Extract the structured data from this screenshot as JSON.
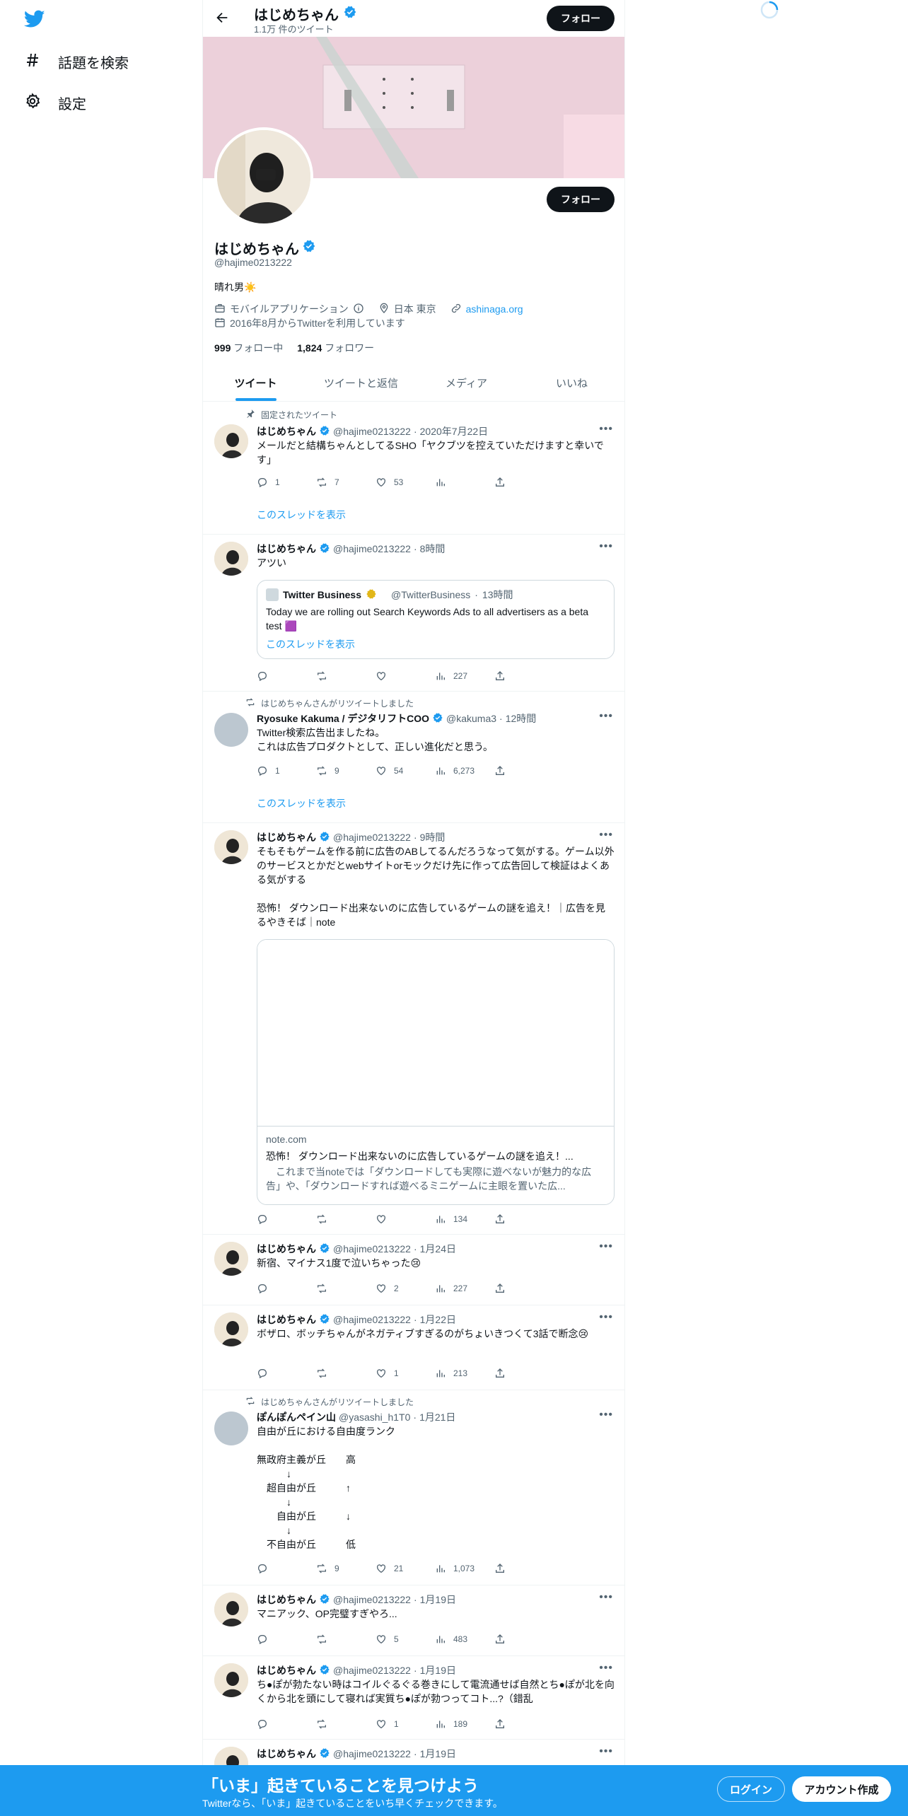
{
  "nav": {
    "explore_label": "話題を検索",
    "settings_label": "設定"
  },
  "header": {
    "name": "はじめちゃん",
    "tweet_count": "1.1万 件のツイート",
    "follow_label": "フォロー"
  },
  "profile": {
    "name": "はじめちゃん",
    "handle": "@hajime0213222",
    "bio": "晴れ男☀️",
    "category": "モバイルアプリケーション",
    "location": "日本 東京",
    "website": "ashinaga.org",
    "joined": "2016年8月からTwitterを利用しています",
    "following_count": "999",
    "following_label": "フォロー中",
    "followers_count": "1,824",
    "followers_label": "フォロワー",
    "follow_label": "フォロー"
  },
  "tabs": [
    "ツイート",
    "ツイートと返信",
    "メディア",
    "いいね"
  ],
  "show_thread": "このスレッドを表示",
  "tweets": [
    {
      "social": "固定されたツイート",
      "name": "はじめちゃん",
      "handle": "@hajime0213222",
      "time": "2020年7月22日",
      "text": "メールだと結構ちゃんとしてるSHO「ヤクブツを控えていただけますと幸いです」",
      "reply": "1",
      "retweet": "7",
      "like": "53",
      "views": ""
    },
    {
      "name": "はじめちゃん",
      "handle": "@hajime0213222",
      "time": "8時間",
      "text": "アツい",
      "quote": {
        "name": "Twitter Business",
        "handle": "@TwitterBusiness",
        "time": "13時間",
        "text": "Today we are rolling out Search Keywords Ads to all advertisers as a beta test 🟪",
        "show_thread": "このスレッドを表示"
      },
      "reply": "",
      "retweet": "",
      "like": "",
      "views": "227"
    },
    {
      "social": "はじめちゃんさんがリツイートしました",
      "name": "Ryosuke Kakuma / デジタリフトCOO",
      "handle": "@kakuma3",
      "time": "12時間",
      "text": "Twitter検索広告出ましたね。\nこれは広告プロダクトとして、正しい進化だと思う。",
      "reply": "1",
      "retweet": "9",
      "like": "54",
      "views": "6,273"
    },
    {
      "name": "はじめちゃん",
      "handle": "@hajime0213222",
      "time": "9時間",
      "text": "そもそもゲームを作る前に広告のABしてるんだろうなって気がする。ゲーム以外のサービスとかだとwebサイトorモックだけ先に作って広告回して検証はよくある気がする\n\n恐怖！ ダウンロード出来ないのに広告しているゲームの謎を追え！｜広告を見るやきそば｜note",
      "card": {
        "domain": "note.com",
        "title": "恐怖！ ダウンロード出来ないのに広告しているゲームの謎を追え！...",
        "desc": "　これまで当noteでは「ダウンロードしても実際に遊べないが魅力的な広告」や、「ダウンロードすれば遊べるミニゲームに主眼を置いた広..."
      },
      "reply": "",
      "retweet": "",
      "like": "",
      "views": "134"
    },
    {
      "name": "はじめちゃん",
      "handle": "@hajime0213222",
      "time": "1月24日",
      "text": "新宿、マイナス1度で泣いちゃった😢",
      "reply": "",
      "retweet": "",
      "like": "2",
      "views": "227"
    },
    {
      "name": "はじめちゃん",
      "handle": "@hajime0213222",
      "time": "1月22日",
      "text": "ボザロ、ボッチちゃんがネガティブすぎるのがちょいきつくて3話で断念😢",
      "reply": "",
      "retweet": "",
      "like": "1",
      "views": "213"
    },
    {
      "social": "はじめちゃんさんがリツイートしました",
      "name": "ぽんぽんペイン山",
      "handle": "@yasashi_h1T0",
      "time": "1月21日",
      "text": "自由が丘における自由度ランク\n\n無政府主義が丘　　高\n　　　↓\n　超自由が丘　　　↑\n　　　↓\n　　自由が丘　　　↓\n　　　↓\n　不自由が丘　　　低",
      "reply": "",
      "retweet": "9",
      "like": "21",
      "views": "1,073"
    },
    {
      "name": "はじめちゃん",
      "handle": "@hajime0213222",
      "time": "1月19日",
      "text": "マニアック、OP完璧すぎやろ...",
      "reply": "",
      "retweet": "",
      "like": "5",
      "views": "483"
    },
    {
      "name": "はじめちゃん",
      "handle": "@hajime0213222",
      "time": "1月19日",
      "text": "ち●ぽが勃たない時はコイルぐるぐる巻きにして電流通せば自然とち●ぽが北を向くから北を頭にして寝れば実質ち●ぽが勃つってコト...?（錯乱",
      "reply": "",
      "retweet": "",
      "like": "1",
      "views": "189"
    },
    {
      "name": "はじめちゃん",
      "handle": "@hajime0213222",
      "time": "1月19日"
    }
  ],
  "bottom": {
    "title": "「いま」起きていることを見つけよう",
    "subtitle": "Twitterなら、「いま」起きていることをいち早くチェックできます。",
    "login": "ログイン",
    "signup": "アカウント作成"
  },
  "colors": {
    "accent": "#1d9bf0",
    "text": "#0f1419",
    "secondary": "#536471",
    "border": "#eff3f4"
  }
}
